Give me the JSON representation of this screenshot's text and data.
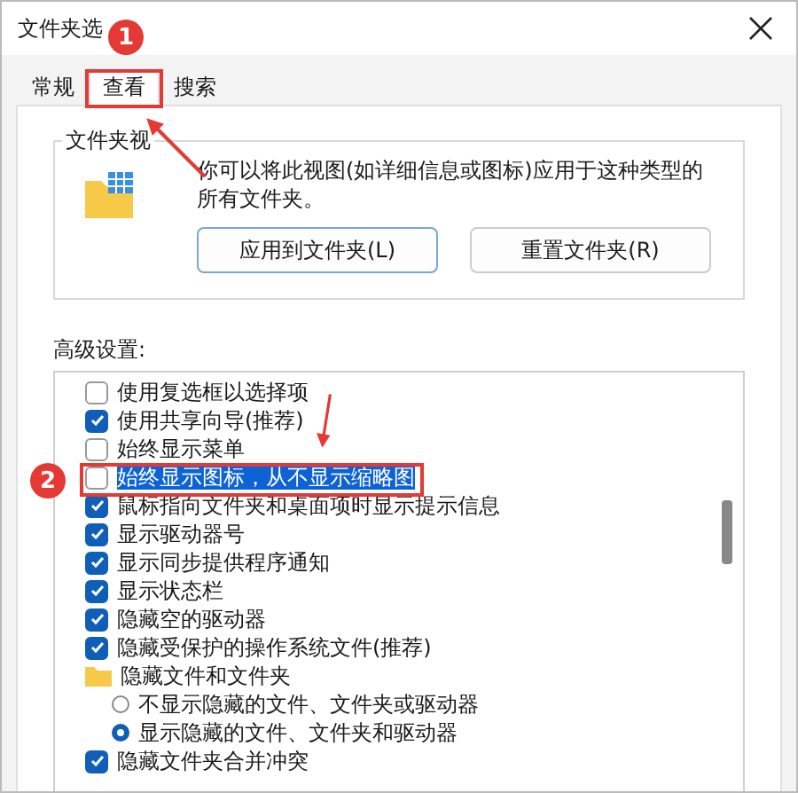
{
  "window": {
    "title": "文件夹选"
  },
  "tabs": [
    {
      "label": "常规",
      "selected": false
    },
    {
      "label": "查看",
      "selected": true
    },
    {
      "label": "搜索",
      "selected": false
    }
  ],
  "folder_views": {
    "title": "文件夹视",
    "description": "你可以将此视图(如详细信息或图标)应用于这种类型的所有文件夹。",
    "buttons": [
      "应用到文件夹(L)",
      "重置文件夹(R)"
    ]
  },
  "advanced": {
    "label": "高级设置:",
    "items": [
      {
        "kind": "checkbox",
        "label": "使用复选框以选择项",
        "checked": false,
        "selected": false
      },
      {
        "kind": "checkbox",
        "label": "使用共享向导(推荐)",
        "checked": true,
        "selected": false
      },
      {
        "kind": "checkbox",
        "label": "始终显示菜单",
        "checked": false,
        "selected": false
      },
      {
        "kind": "checkbox",
        "label": "始终显示图标，从不显示缩略图",
        "checked": false,
        "selected": true
      },
      {
        "kind": "checkbox",
        "label": "鼠标指向文件夹和桌面项时显示提示信息",
        "checked": true,
        "selected": false
      },
      {
        "kind": "checkbox",
        "label": "显示驱动器号",
        "checked": true,
        "selected": false
      },
      {
        "kind": "checkbox",
        "label": "显示同步提供程序通知",
        "checked": true,
        "selected": false
      },
      {
        "kind": "checkbox",
        "label": "显示状态栏",
        "checked": true,
        "selected": false
      },
      {
        "kind": "checkbox",
        "label": "隐藏空的驱动器",
        "checked": true,
        "selected": false
      },
      {
        "kind": "checkbox",
        "label": "隐藏受保护的操作系统文件(推荐)",
        "checked": true,
        "selected": false
      },
      {
        "kind": "folder",
        "label": "隐藏文件和文件夹",
        "selected": false,
        "children": [
          {
            "kind": "radio",
            "label": "不显示隐藏的文件、文件夹或驱动器",
            "checked": false,
            "selected": false
          },
          {
            "kind": "radio",
            "label": "显示隐藏的文件、文件夹和驱动器",
            "checked": true,
            "selected": false
          }
        ]
      },
      {
        "kind": "checkbox",
        "label": "隐藏文件夹合并冲突",
        "checked": true,
        "selected": false
      }
    ]
  },
  "annotations": [
    {
      "number": "1"
    },
    {
      "number": "2"
    }
  ]
}
